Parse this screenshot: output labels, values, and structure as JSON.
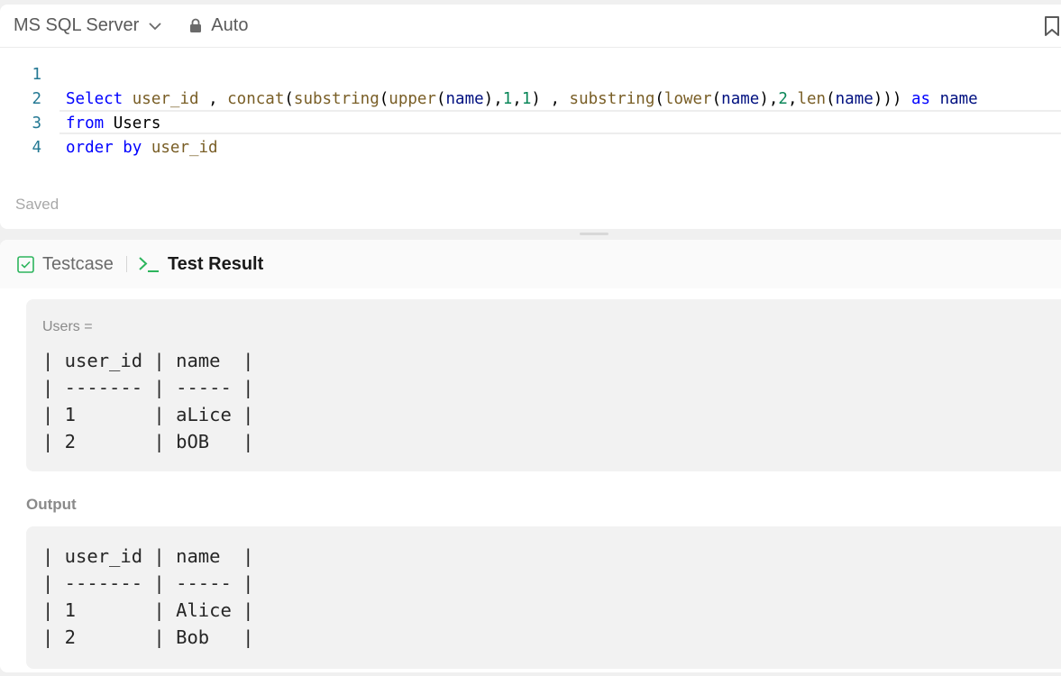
{
  "toolbar": {
    "language": "MS SQL Server",
    "mode": "Auto"
  },
  "editor": {
    "lines": [
      {
        "no": "1",
        "tokens": []
      },
      {
        "no": "2",
        "tokens": [
          {
            "t": "Select",
            "c": "kw"
          },
          {
            "t": " ",
            "c": "pl"
          },
          {
            "t": "user_id",
            "c": "fn"
          },
          {
            "t": " , ",
            "c": "pl"
          },
          {
            "t": "concat",
            "c": "fn"
          },
          {
            "t": "(",
            "c": "pl"
          },
          {
            "t": "substring",
            "c": "fn"
          },
          {
            "t": "(",
            "c": "pl"
          },
          {
            "t": "upper",
            "c": "fn"
          },
          {
            "t": "(",
            "c": "pl"
          },
          {
            "t": "name",
            "c": "id"
          },
          {
            "t": "),",
            "c": "pl"
          },
          {
            "t": "1",
            "c": "num"
          },
          {
            "t": ",",
            "c": "pl"
          },
          {
            "t": "1",
            "c": "num"
          },
          {
            "t": ") , ",
            "c": "pl"
          },
          {
            "t": "substring",
            "c": "fn"
          },
          {
            "t": "(",
            "c": "pl"
          },
          {
            "t": "lower",
            "c": "fn"
          },
          {
            "t": "(",
            "c": "pl"
          },
          {
            "t": "name",
            "c": "id"
          },
          {
            "t": "),",
            "c": "pl"
          },
          {
            "t": "2",
            "c": "num"
          },
          {
            "t": ",",
            "c": "pl"
          },
          {
            "t": "len",
            "c": "fn"
          },
          {
            "t": "(",
            "c": "pl"
          },
          {
            "t": "name",
            "c": "id"
          },
          {
            "t": "))) ",
            "c": "pl"
          },
          {
            "t": "as",
            "c": "kw"
          },
          {
            "t": " ",
            "c": "pl"
          },
          {
            "t": "name",
            "c": "id"
          }
        ]
      },
      {
        "no": "3",
        "tokens": [
          {
            "t": "from",
            "c": "kw"
          },
          {
            "t": " Users",
            "c": "pl"
          }
        ]
      },
      {
        "no": "4",
        "tokens": [
          {
            "t": "order by",
            "c": "kw"
          },
          {
            "t": " ",
            "c": "pl"
          },
          {
            "t": "user_id",
            "c": "fn"
          }
        ]
      }
    ],
    "status": "Saved"
  },
  "tabs": {
    "testcase": "Testcase",
    "test_result": "Test Result"
  },
  "input": {
    "label": "Users =",
    "rows": [
      "| user_id | name  |",
      "| ------- | ----- |",
      "| 1       | aLice |",
      "| 2       | bOB   |"
    ]
  },
  "output": {
    "label": "Output",
    "rows": [
      "| user_id | name  |",
      "| ------- | ----- |",
      "| 1       | Alice |",
      "| 2       | Bob   |"
    ]
  },
  "colors": {
    "keyword": "#0000ff",
    "function": "#795e26",
    "identifier": "#001080",
    "number": "#098658",
    "line_number": "#237893",
    "test_result_icon": "#2db55d"
  },
  "icons": [
    "chevron-down-icon",
    "lock-icon",
    "bookmark-icon",
    "checkbox-icon",
    "terminal-icon"
  ]
}
